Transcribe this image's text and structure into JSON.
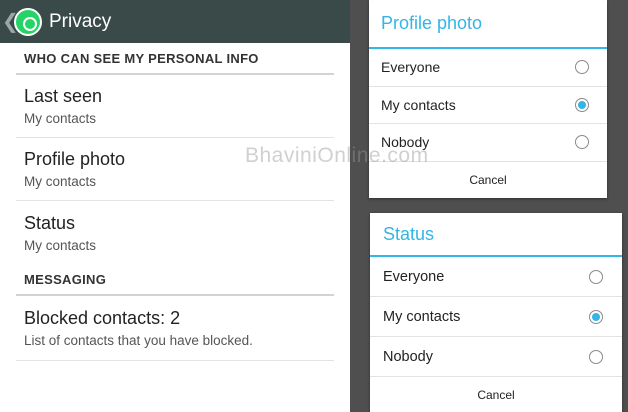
{
  "actionbar": {
    "title": "Privacy",
    "back_icon": "chevron-left-icon",
    "logo_icon": "whatsapp-logo-icon",
    "background": "#3a4a49"
  },
  "sections": {
    "personal_header": "WHO CAN SEE MY PERSONAL INFO",
    "messaging_header": "MESSAGING"
  },
  "prefs": [
    {
      "title": "Last seen",
      "summary": "My contacts"
    },
    {
      "title": "Profile photo",
      "summary": "My contacts"
    },
    {
      "title": "Status",
      "summary": "My contacts"
    }
  ],
  "blocked": {
    "title": "Blocked contacts: 2",
    "summary": "List of contacts that you have blocked."
  },
  "dialog_profile": {
    "title": "Profile photo",
    "options": [
      "Everyone",
      "My contacts",
      "Nobody"
    ],
    "selected": "My contacts",
    "cancel": "Cancel"
  },
  "dialog_status": {
    "title": "Status",
    "options": [
      "Everyone",
      "My contacts",
      "Nobody"
    ],
    "selected": "My contacts",
    "cancel": "Cancel"
  },
  "watermark": "BhaviniOnline.com",
  "accent_color": "#33b5e5"
}
